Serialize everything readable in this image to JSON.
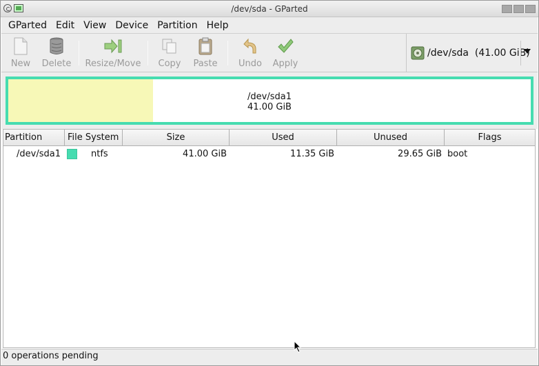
{
  "window": {
    "title": "/dev/sda - GParted"
  },
  "menu": [
    "GParted",
    "Edit",
    "View",
    "Device",
    "Partition",
    "Help"
  ],
  "toolbar": {
    "new": "New",
    "delete": "Delete",
    "resize_move": "Resize/Move",
    "copy": "Copy",
    "paste": "Paste",
    "undo": "Undo",
    "apply": "Apply"
  },
  "device": {
    "selected": "/dev/sda  (41.00 GiB)"
  },
  "diskmap": {
    "partition": "/dev/sda1",
    "size": "41.00 GiB",
    "used_fraction": 0.277,
    "border_color": "#46dcb0",
    "used_color": "#f7f8b7"
  },
  "table": {
    "columns": [
      "Partition",
      "File System",
      "Size",
      "Used",
      "Unused",
      "Flags"
    ],
    "rows": [
      {
        "partition": "/dev/sda1",
        "filesystem": "ntfs",
        "fs_color": "#46dcb0",
        "size": "41.00 GiB",
        "used": "11.35 GiB",
        "unused": "29.65 GiB",
        "flags": "boot"
      }
    ]
  },
  "status": {
    "text": "0 operations pending"
  }
}
